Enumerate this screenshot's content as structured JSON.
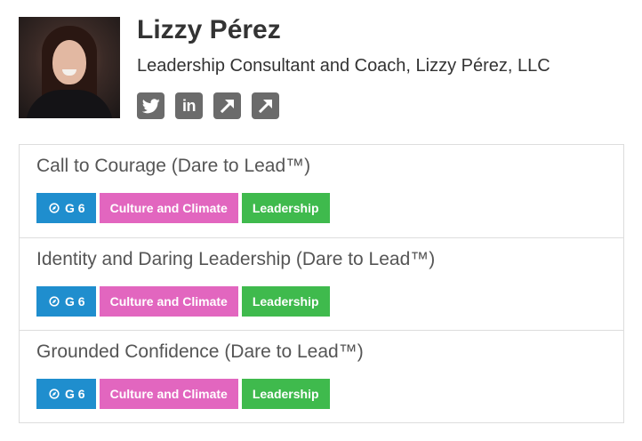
{
  "profile": {
    "name": "Lizzy Pérez",
    "title": "Leadership Consultant and Coach, Lizzy Pérez, LLC",
    "social_links": [
      {
        "icon": "twitter-icon"
      },
      {
        "icon": "linkedin-icon",
        "glyph": "in"
      },
      {
        "icon": "external-link-icon"
      },
      {
        "icon": "external-link-icon"
      }
    ]
  },
  "colors": {
    "grade_badge": "#1f8ece",
    "topic_badge": "#e266bf",
    "category_badge": "#3fba4d",
    "social_icon": "#6b6b6b"
  },
  "sessions": [
    {
      "title": "Call to Courage (Dare to Lead™)",
      "grade": "G 6",
      "topic": "Culture and Climate",
      "category": "Leadership"
    },
    {
      "title": "Identity and Daring Leadership (Dare to Lead™)",
      "grade": "G 6",
      "topic": "Culture and Climate",
      "category": "Leadership"
    },
    {
      "title": "Grounded Confidence (Dare to Lead™)",
      "grade": "G 6",
      "topic": "Culture and Climate",
      "category": "Leadership"
    }
  ]
}
